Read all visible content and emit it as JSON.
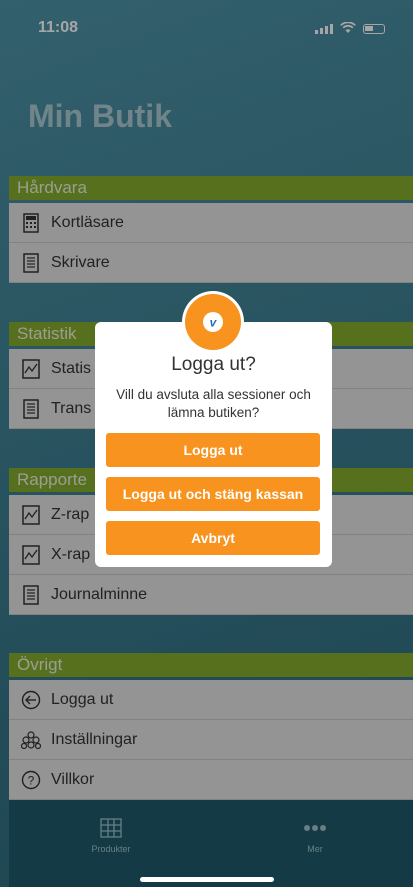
{
  "status_bar": {
    "time": "11:08"
  },
  "app": {
    "title": "Min Butik"
  },
  "sections": [
    {
      "header": "Hårdvara",
      "items": [
        {
          "label": "Kortläsare",
          "icon": "calculator-icon"
        },
        {
          "label": "Skrivare",
          "icon": "receipt-icon"
        }
      ]
    },
    {
      "header": "Statistik",
      "items": [
        {
          "label": "Statis",
          "icon": "chart-icon"
        },
        {
          "label": "Trans",
          "icon": "receipt-icon"
        }
      ]
    },
    {
      "header": "Rapporte",
      "items": [
        {
          "label": "Z-rap",
          "icon": "chart-icon"
        },
        {
          "label": "X-rap",
          "icon": "chart-icon"
        },
        {
          "label": "Journalminne",
          "icon": "receipt-icon"
        }
      ]
    },
    {
      "header": "Övrigt",
      "items": [
        {
          "label": "Logga ut",
          "icon": "logout-arrow-icon"
        },
        {
          "label": "Inställningar",
          "icon": "settings-cubes-icon"
        },
        {
          "label": "Villkor",
          "icon": "question-icon"
        }
      ]
    }
  ],
  "tabbar": {
    "tabs": [
      {
        "label": "Produkter",
        "icon": "grid-icon"
      },
      {
        "label": "Mer",
        "icon": "more-dots-icon"
      }
    ]
  },
  "dialog": {
    "title": "Logga ut?",
    "message": "Vill du avsluta alla sessioner och lämna butiken?",
    "buttons": {
      "logout": "Logga ut",
      "logout_close": "Logga ut och stäng kassan",
      "cancel": "Avbryt"
    },
    "badge_icon": "v-logo-icon"
  },
  "colors": {
    "accent": "#f7931e",
    "section_header": "#86ad2e",
    "row_bg": "#e4e4e4",
    "tabbar": "#1f5b6b"
  }
}
